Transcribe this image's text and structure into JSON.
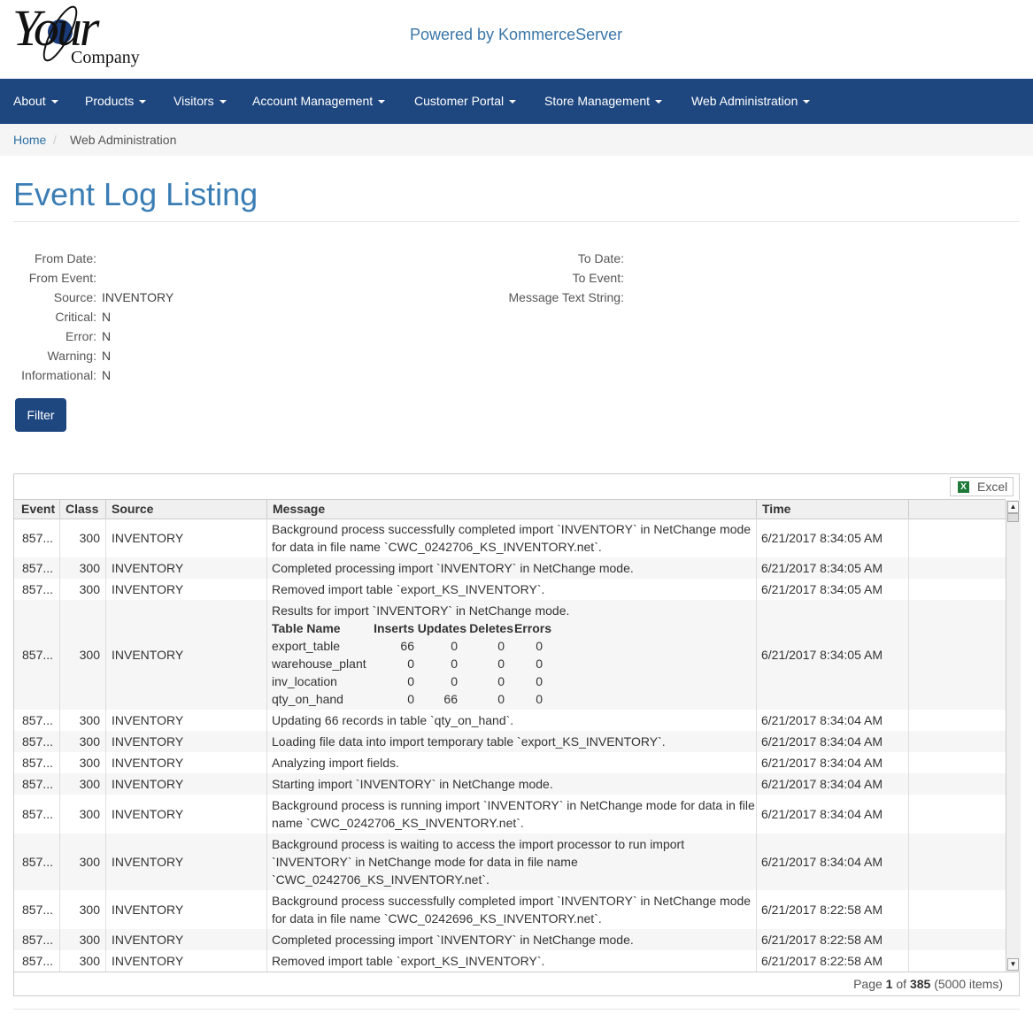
{
  "brand": {
    "logo_word": "Your",
    "logo_company": "Company",
    "powered_by": "Powered by KommerceServer"
  },
  "nav": {
    "items": [
      "About",
      "Products",
      "Visitors",
      "Account Management",
      "Customer Portal",
      "Store Management",
      "Web Administration"
    ]
  },
  "breadcrumb": {
    "home": "Home",
    "separator": "/",
    "current": "Web Administration"
  },
  "page": {
    "title": "Event Log Listing"
  },
  "filters": {
    "left": [
      {
        "label": "From Date:",
        "value": ""
      },
      {
        "label": "From Event:",
        "value": ""
      },
      {
        "label": "Source:",
        "value": "INVENTORY"
      },
      {
        "label": "Critical:",
        "value": "N"
      },
      {
        "label": "Error:",
        "value": "N"
      },
      {
        "label": "Warning:",
        "value": "N"
      },
      {
        "label": "Informational:",
        "value": "N"
      }
    ],
    "right": [
      {
        "label": "To Date:",
        "value": ""
      },
      {
        "label": "To Event:",
        "value": ""
      },
      {
        "label": "Message Text String:",
        "value": ""
      }
    ],
    "filter_button": "Filter"
  },
  "grid": {
    "excel_label": "Excel",
    "columns": [
      "Event",
      "Class",
      "Source",
      "Message",
      "Time"
    ],
    "rows": [
      {
        "event": "857...",
        "class": "300",
        "source": "INVENTORY",
        "message": "Background process successfully completed import `INVENTORY` in NetChange mode for data in file name `CWC_0242706_KS_INVENTORY.net`.",
        "time": "6/21/2017 8:34:05 AM"
      },
      {
        "event": "857...",
        "class": "300",
        "source": "INVENTORY",
        "message": "Completed processing import `INVENTORY` in NetChange mode.",
        "time": "6/21/2017 8:34:05 AM"
      },
      {
        "event": "857...",
        "class": "300",
        "source": "INVENTORY",
        "message": "Removed import table `export_KS_INVENTORY`.",
        "time": "6/21/2017 8:34:05 AM"
      },
      {
        "event": "857...",
        "class": "300",
        "source": "INVENTORY",
        "message": "Results for import `INVENTORY` in NetChange mode.",
        "time": "6/21/2017 8:34:05 AM",
        "results": {
          "headers": [
            "Table Name",
            "Inserts",
            "Updates",
            "Deletes",
            "Errors"
          ],
          "rows": [
            [
              "export_table",
              "66",
              "0",
              "0",
              "0"
            ],
            [
              "warehouse_plant",
              "0",
              "0",
              "0",
              "0"
            ],
            [
              "inv_location",
              "0",
              "0",
              "0",
              "0"
            ],
            [
              "qty_on_hand",
              "0",
              "66",
              "0",
              "0"
            ]
          ]
        }
      },
      {
        "event": "857...",
        "class": "300",
        "source": "INVENTORY",
        "message": "Updating 66 records in table `qty_on_hand`.",
        "time": "6/21/2017 8:34:04 AM"
      },
      {
        "event": "857...",
        "class": "300",
        "source": "INVENTORY",
        "message": "Loading file data into import temporary table `export_KS_INVENTORY`.",
        "time": "6/21/2017 8:34:04 AM"
      },
      {
        "event": "857...",
        "class": "300",
        "source": "INVENTORY",
        "message": "Analyzing import fields.",
        "time": "6/21/2017 8:34:04 AM"
      },
      {
        "event": "857...",
        "class": "300",
        "source": "INVENTORY",
        "message": "Starting import `INVENTORY` in NetChange mode.",
        "time": "6/21/2017 8:34:04 AM"
      },
      {
        "event": "857...",
        "class": "300",
        "source": "INVENTORY",
        "message": "Background process is running import `INVENTORY` in NetChange mode for data in file name `CWC_0242706_KS_INVENTORY.net`.",
        "time": "6/21/2017 8:34:04 AM"
      },
      {
        "event": "857...",
        "class": "300",
        "source": "INVENTORY",
        "message": "Background process is waiting to access the import processor to run import `INVENTORY` in NetChange mode for data in file name `CWC_0242706_KS_INVENTORY.net`.",
        "time": "6/21/2017 8:34:04 AM"
      },
      {
        "event": "857...",
        "class": "300",
        "source": "INVENTORY",
        "message": "Background process successfully completed import `INVENTORY` in NetChange mode for data in file name `CWC_0242696_KS_INVENTORY.net`.",
        "time": "6/21/2017 8:22:58 AM"
      },
      {
        "event": "857...",
        "class": "300",
        "source": "INVENTORY",
        "message": "Completed processing import `INVENTORY` in NetChange mode.",
        "time": "6/21/2017 8:22:58 AM"
      },
      {
        "event": "857...",
        "class": "300",
        "source": "INVENTORY",
        "message": "Removed import table `export_KS_INVENTORY`.",
        "time": "6/21/2017 8:22:58 AM"
      }
    ]
  },
  "pager": {
    "page_word": "Page",
    "current": "1",
    "of_word": "of",
    "total_pages": "385",
    "items": "(5000 items)"
  }
}
